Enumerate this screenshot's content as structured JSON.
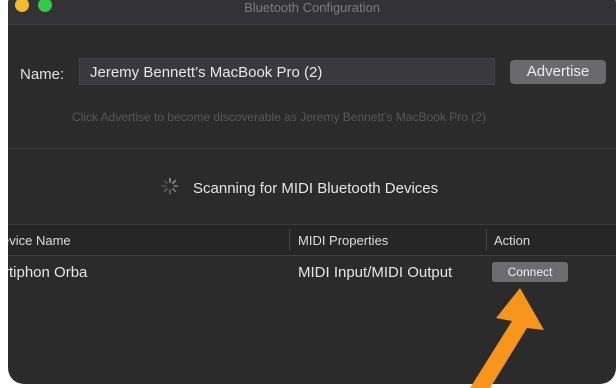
{
  "window": {
    "title": "Bluetooth Configuration"
  },
  "name_field": {
    "label": "Name:",
    "value": "Jeremy Bennett’s MacBook Pro (2)"
  },
  "advertise_button": {
    "label": "Advertise"
  },
  "hint": "Click Advertise to become discoverable as Jeremy Bennett’s MacBook Pro (2)",
  "scanning": {
    "text": "Scanning for MIDI Bluetooth Devices",
    "icon": "spinner-icon"
  },
  "table": {
    "columns": [
      "evice Name",
      "MIDI Properties",
      "Action"
    ],
    "rows": [
      {
        "device": "rtiphon Orba",
        "properties": "MIDI Input/MIDI Output",
        "action": "Connect"
      }
    ]
  },
  "colors": {
    "window_bg": "#2b2b2c",
    "button_bg": "#6a6a6d",
    "arrow": "#f7951d"
  },
  "annotation": {
    "icon": "arrow-icon"
  }
}
